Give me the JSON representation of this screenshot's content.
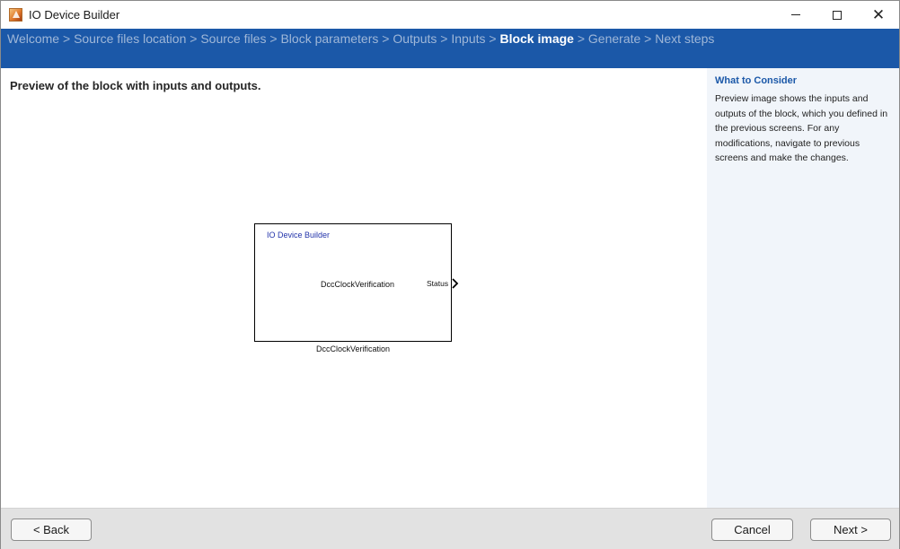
{
  "window": {
    "title": "IO Device Builder",
    "icon": "matlab-icon"
  },
  "breadcrumb": [
    {
      "label": "Welcome",
      "active": false
    },
    {
      "label": "Source files location",
      "active": false
    },
    {
      "label": "Source files",
      "active": false
    },
    {
      "label": "Block parameters",
      "active": false
    },
    {
      "label": "Outputs",
      "active": false
    },
    {
      "label": "Inputs",
      "active": false
    },
    {
      "label": "Block image",
      "active": true
    },
    {
      "label": "Generate",
      "active": false
    },
    {
      "label": "Next steps",
      "active": false
    }
  ],
  "breadcrumb_separator": ">",
  "main": {
    "heading": "Preview of the block with inputs and outputs.",
    "block": {
      "header": "IO Device Builder",
      "name": "DccClockVerification",
      "output_port": "Status",
      "caption": "DccClockVerification"
    }
  },
  "side_panel": {
    "title": "What to Consider",
    "text": "Preview image shows the inputs and outputs of the block, which you defined in the previous screens. For any modifications, navigate to previous screens and make the changes."
  },
  "footer": {
    "back_label": "< Back",
    "cancel_label": "Cancel",
    "next_label": "Next >"
  },
  "colors": {
    "banner": "#1b58a8",
    "active_crumb": "#ffffff",
    "inactive_crumb": "#9fb7d8",
    "side_title": "#1b58a8"
  }
}
